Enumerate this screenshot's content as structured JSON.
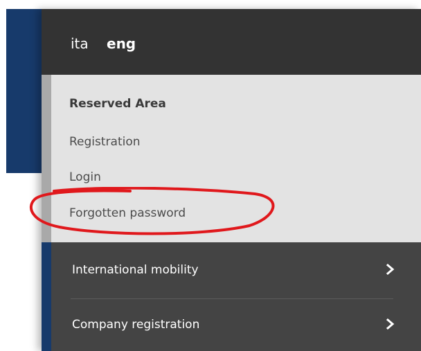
{
  "languages": {
    "ita": "ita",
    "eng": "eng"
  },
  "reserved_area": {
    "title": "Reserved Area",
    "links": {
      "registration": "Registration",
      "login": "Login",
      "forgotten_password": "Forgotten password"
    }
  },
  "menu": {
    "items": [
      {
        "label": "International mobility",
        "icon": "chevron-right-icon"
      },
      {
        "label": "Company registration",
        "icon": "chevron-right-icon"
      }
    ]
  },
  "annotation": {
    "color": "#e0181c",
    "target": "forgotten_password"
  },
  "colors": {
    "dark_header": "#333333",
    "menu_bg": "#444444",
    "reserved_bg": "#e3e3e3",
    "navy": "#173a6b"
  }
}
